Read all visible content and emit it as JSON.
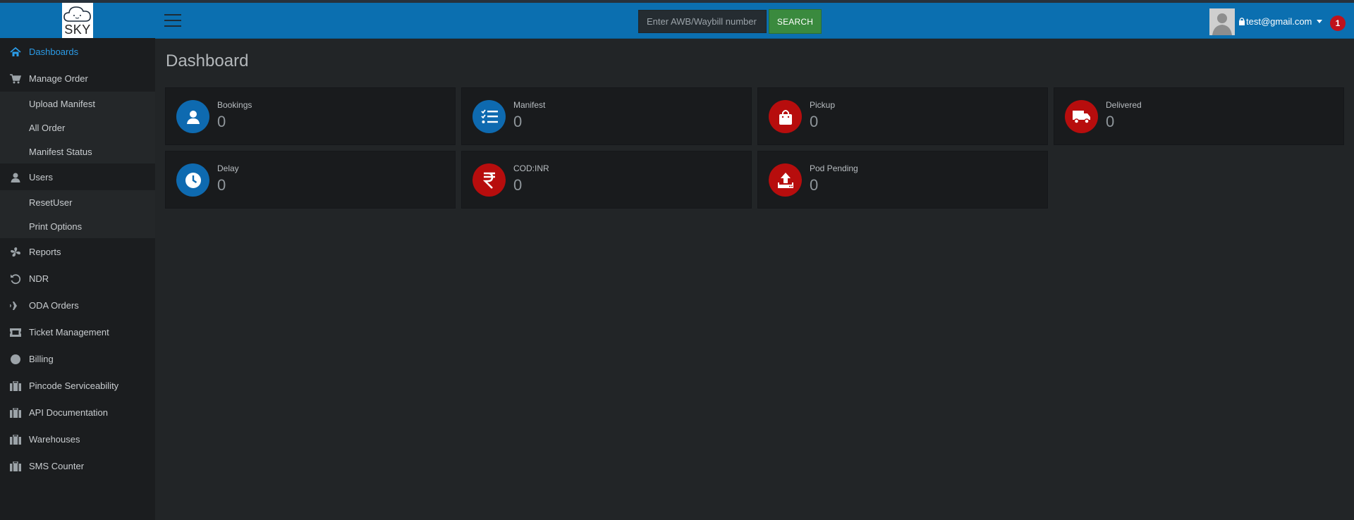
{
  "brand": {
    "logo_text": "SKY"
  },
  "header": {
    "search_placeholder": "Enter AWB/Waybill number",
    "search_button": "SEARCH",
    "user_email": "test@gmail.com",
    "notification_count": "1"
  },
  "sidebar": {
    "items": [
      {
        "label": "Dashboards",
        "icon": "home-icon",
        "active": true
      },
      {
        "label": "Manage Order",
        "icon": "cart-icon"
      },
      {
        "label": "Users",
        "icon": "user-icon"
      },
      {
        "label": "Reports",
        "icon": "fan-icon"
      },
      {
        "label": "NDR",
        "icon": "undo-icon"
      },
      {
        "label": "ODA Orders",
        "icon": "plane-icon"
      },
      {
        "label": "Ticket Management",
        "icon": "ticket-icon"
      },
      {
        "label": "Billing",
        "icon": "circle-icon"
      },
      {
        "label": "Pincode Serviceability",
        "icon": "briefcase-icon"
      },
      {
        "label": "API Documentation",
        "icon": "briefcase-icon"
      },
      {
        "label": "Warehouses",
        "icon": "briefcase-icon"
      },
      {
        "label": "SMS Counter",
        "icon": "briefcase-icon"
      }
    ],
    "manage_order_sub": [
      "Upload Manifest",
      "All Order",
      "Manifest Status"
    ],
    "users_sub": [
      "ResetUser",
      "Print Options"
    ]
  },
  "main": {
    "title": "Dashboard",
    "cards": [
      {
        "title": "Bookings",
        "value": "0",
        "icon": "user-icon",
        "color": "#0e6ab0"
      },
      {
        "title": "Manifest",
        "value": "0",
        "icon": "checklist-icon",
        "color": "#0e6ab0"
      },
      {
        "title": "Pickup",
        "value": "0",
        "icon": "shopping-bag-icon",
        "color": "#b70d0d"
      },
      {
        "title": "Delivered",
        "value": "0",
        "icon": "truck-icon",
        "color": "#b70d0d"
      },
      {
        "title": "Delay",
        "value": "0",
        "icon": "clock-icon",
        "color": "#0e6ab0"
      },
      {
        "title": "COD:INR",
        "value": "0",
        "icon": "rupee-icon",
        "color": "#b70d0d"
      },
      {
        "title": "Pod Pending",
        "value": "0",
        "icon": "upload-icon",
        "color": "#b70d0d"
      }
    ]
  },
  "colors": {
    "header": "#0b6fb0",
    "sidebar": "#1b1d1f",
    "content": "#222527",
    "accent": "#2b9be6",
    "search_button": "#3a8a3e",
    "badge": "#c0121b"
  }
}
